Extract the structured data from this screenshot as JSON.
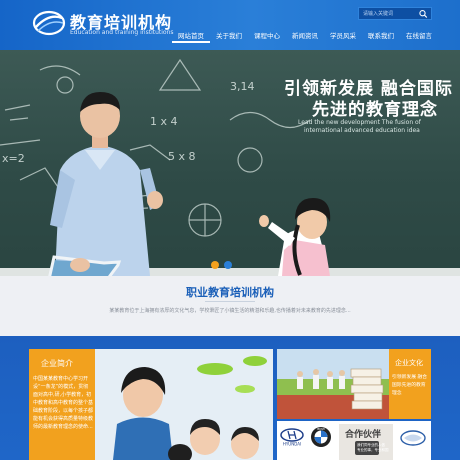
{
  "header": {
    "logo_title": "教育培训机构",
    "logo_subtitle": "Education and training institutions",
    "search_placeholder": "请输入关键词",
    "search_icon": "search-icon",
    "nav": [
      {
        "label": "网站首页",
        "active": true
      },
      {
        "label": "关于我们",
        "active": false
      },
      {
        "label": "课程中心",
        "active": false
      },
      {
        "label": "新闻资讯",
        "active": false
      },
      {
        "label": "学员风采",
        "active": false
      },
      {
        "label": "联系我们",
        "active": false
      },
      {
        "label": "在线留言",
        "active": false
      }
    ]
  },
  "banner": {
    "headline_line1": "引领新发展 融合国际",
    "headline_line2": "先进的教育理念",
    "sub_line1": "Lead the new development The fusion of",
    "sub_line2": "international advanced education idea",
    "board_texts": [
      "1 x 4",
      "5 x 8",
      "x=2",
      "3,14"
    ],
    "slides": [
      {
        "active": true
      },
      {
        "active": false
      }
    ],
    "colors": {
      "dot_active": "#f2a11e",
      "dot_inactive": "#2a7fd8"
    }
  },
  "intro": {
    "title": "职业教育培训机构",
    "text": "某某教育位于上海拥有浓厚的文化气息，学校秉匠了小镇生活的精湛和乐趣,也传播着对未来教育的先进理念..."
  },
  "about": {
    "title": "企业简介",
    "text": "中国某某教育中心学习开设“一条龙”的模式，贯彻面对高中,研,小学教育，初中教育和高中教育的整个基础教育阶段，以每个孩子都能有机会获得高质量特级教师的最新教育理念的使命..."
  },
  "culture": {
    "title": "企业文化",
    "text": "引领新发展 融合国际先进的教育理念"
  },
  "partners": {
    "brands": [
      "HYUNDAI",
      "BMW"
    ],
    "cooperation_title": "合作伙伴",
    "cooperation_line1": "我们同专业的人做",
    "cooperation_line2": "专业的事，专业和国"
  },
  "colors": {
    "brand_blue": "#1565c8",
    "accent_orange": "#f2a11e",
    "board_green": "#3d5a55"
  }
}
